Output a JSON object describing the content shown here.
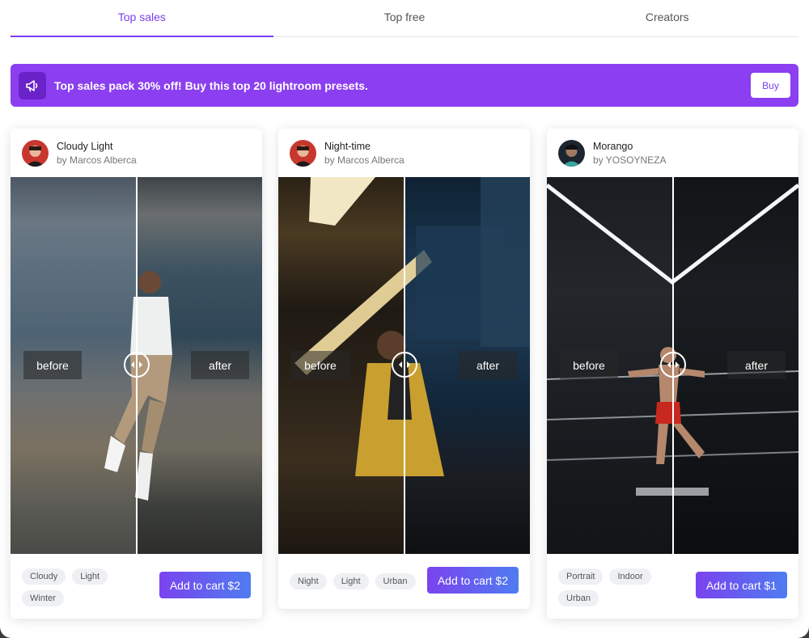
{
  "tabs": [
    {
      "label": "Top sales",
      "active": true
    },
    {
      "label": "Top free",
      "active": false
    },
    {
      "label": "Creators",
      "active": false
    }
  ],
  "banner": {
    "text": "Top sales pack 30% off! Buy this top 20 lightroom presets.",
    "buy_label": "Buy",
    "icon": "megaphone-icon",
    "color": "#8b3ff0"
  },
  "cards": [
    {
      "title": "Cloudy Light",
      "author": "by Marcos Alberca",
      "before_label": "before",
      "after_label": "after",
      "tags": [
        "Cloudy",
        "Light",
        "Winter"
      ],
      "cart_label": "Add to cart $2"
    },
    {
      "title": "Night-time",
      "author": "by Marcos Alberca",
      "before_label": "before",
      "after_label": "after",
      "tags": [
        "Night",
        "Light",
        "Urban"
      ],
      "cart_label": "Add to cart $2"
    },
    {
      "title": "Morango",
      "author": "by YOSOYNEZA",
      "before_label": "before",
      "after_label": "after",
      "tags": [
        "Portrait",
        "Indoor",
        "Urban"
      ],
      "cart_label": "Add to cart $1"
    }
  ],
  "accent_color": "#7b3ff2"
}
